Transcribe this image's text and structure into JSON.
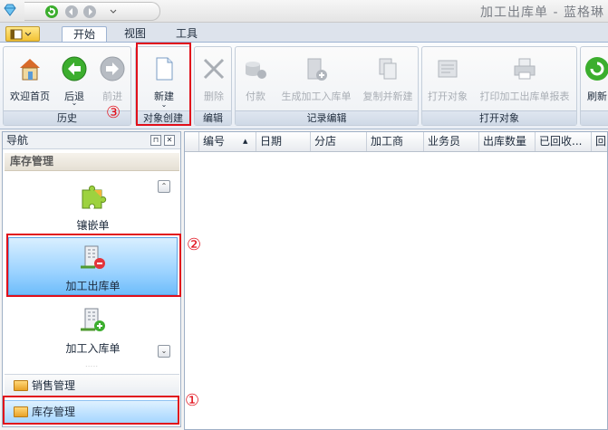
{
  "window": {
    "title": "加工出库单 - 蓝格琳"
  },
  "tabs": [
    {
      "label": "开始"
    },
    {
      "label": "视图"
    },
    {
      "label": "工具"
    }
  ],
  "ribbon": {
    "groups": [
      {
        "caption": "历史",
        "buttons": [
          "欢迎首页",
          "后退",
          "前进"
        ]
      },
      {
        "caption": "对象创建",
        "buttons": [
          "新建"
        ]
      },
      {
        "caption": "编辑",
        "buttons": [
          "删除"
        ]
      },
      {
        "caption": "记录编辑",
        "buttons": [
          "付款",
          "生成加工入库单",
          "复制并新建"
        ]
      },
      {
        "caption": "打开对象",
        "buttons": [
          "打开对象",
          "打印加工出库单报表"
        ]
      },
      {
        "caption": "",
        "buttons": [
          "刷新"
        ]
      }
    ]
  },
  "nav": {
    "title": "导航",
    "section": "库存管理",
    "items": [
      {
        "label": "镶嵌单"
      },
      {
        "label": "加工出库单"
      },
      {
        "label": "加工入库单"
      }
    ],
    "bars": [
      {
        "label": "销售管理"
      },
      {
        "label": "库存管理"
      }
    ]
  },
  "grid": {
    "columns": [
      "编号",
      "日期",
      "分店",
      "加工商",
      "业务员",
      "出库数量",
      "已回收...",
      "回"
    ]
  },
  "callouts": [
    "①",
    "②",
    "③"
  ],
  "colors": {
    "highlight": "#e1101b",
    "selected": "#9cd3ff",
    "accent": "#5ca3e4"
  }
}
